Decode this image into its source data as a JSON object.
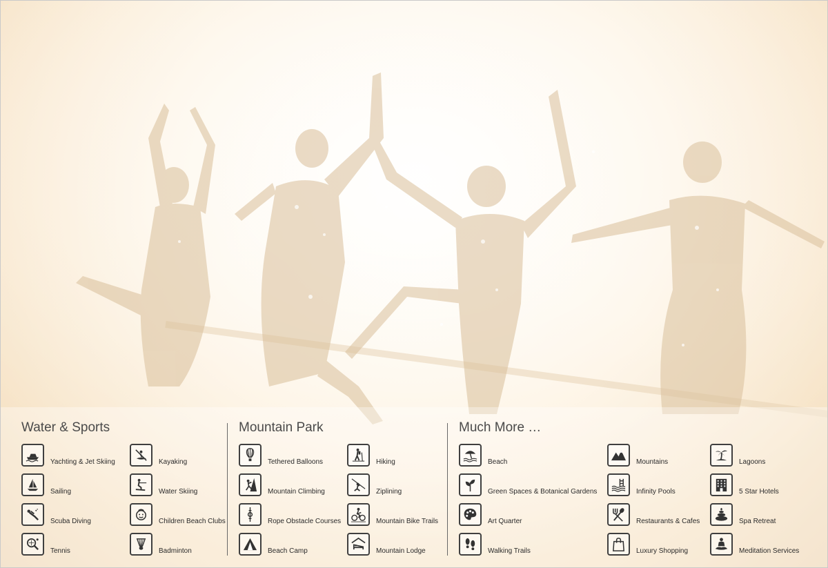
{
  "sections": {
    "water": {
      "title": "Water & Sports",
      "items": [
        {
          "label": "Yachting & Jet Skiing",
          "icon": "yacht-icon"
        },
        {
          "label": "Kayaking",
          "icon": "kayak-icon"
        },
        {
          "label": "Sailing",
          "icon": "sailboat-icon"
        },
        {
          "label": "Water Skiing",
          "icon": "water-ski-icon"
        },
        {
          "label": "Scuba Diving",
          "icon": "scuba-diver-icon"
        },
        {
          "label": "Children Beach Clubs",
          "icon": "child-face-icon"
        },
        {
          "label": "Tennis",
          "icon": "tennis-racket-icon"
        },
        {
          "label": "Badminton",
          "icon": "shuttlecock-icon"
        }
      ]
    },
    "mountain": {
      "title": "Mountain Park",
      "items": [
        {
          "label": "Tethered Balloons",
          "icon": "hot-air-balloon-icon"
        },
        {
          "label": "Hiking",
          "icon": "hiker-icon"
        },
        {
          "label": "Mountain Climbing",
          "icon": "climber-icon"
        },
        {
          "label": "Ziplining",
          "icon": "zipline-icon"
        },
        {
          "label": "Rope Obstacle Courses",
          "icon": "rope-obstacle-icon"
        },
        {
          "label": "Mountain Bike Trails",
          "icon": "mountain-bike-icon"
        },
        {
          "label": "Beach Camp",
          "icon": "tent-icon"
        },
        {
          "label": "Mountain Lodge",
          "icon": "lodge-bed-icon"
        }
      ]
    },
    "more": {
      "title": "Much More …",
      "items": [
        {
          "label": "Beach",
          "icon": "beach-umbrella-icon"
        },
        {
          "label": "Mountains",
          "icon": "mountains-icon"
        },
        {
          "label": "Lagoons",
          "icon": "palm-island-icon"
        },
        {
          "label": "Green Spaces & Botanical Gardens",
          "icon": "plant-icon"
        },
        {
          "label": "Infinity Pools",
          "icon": "pool-ladder-icon"
        },
        {
          "label": "5 Star Hotels",
          "icon": "hotel-building-icon"
        },
        {
          "label": "Art Quarter",
          "icon": "paint-palette-icon"
        },
        {
          "label": "Restaurants & Cafes",
          "icon": "fork-spoon-icon"
        },
        {
          "label": "Spa Retreat",
          "icon": "spa-stones-icon"
        },
        {
          "label": "Walking Trails",
          "icon": "footprints-icon"
        },
        {
          "label": "Luxury Shopping",
          "icon": "shopping-bag-icon"
        },
        {
          "label": "Meditation Services",
          "icon": "meditation-icon"
        }
      ]
    }
  }
}
